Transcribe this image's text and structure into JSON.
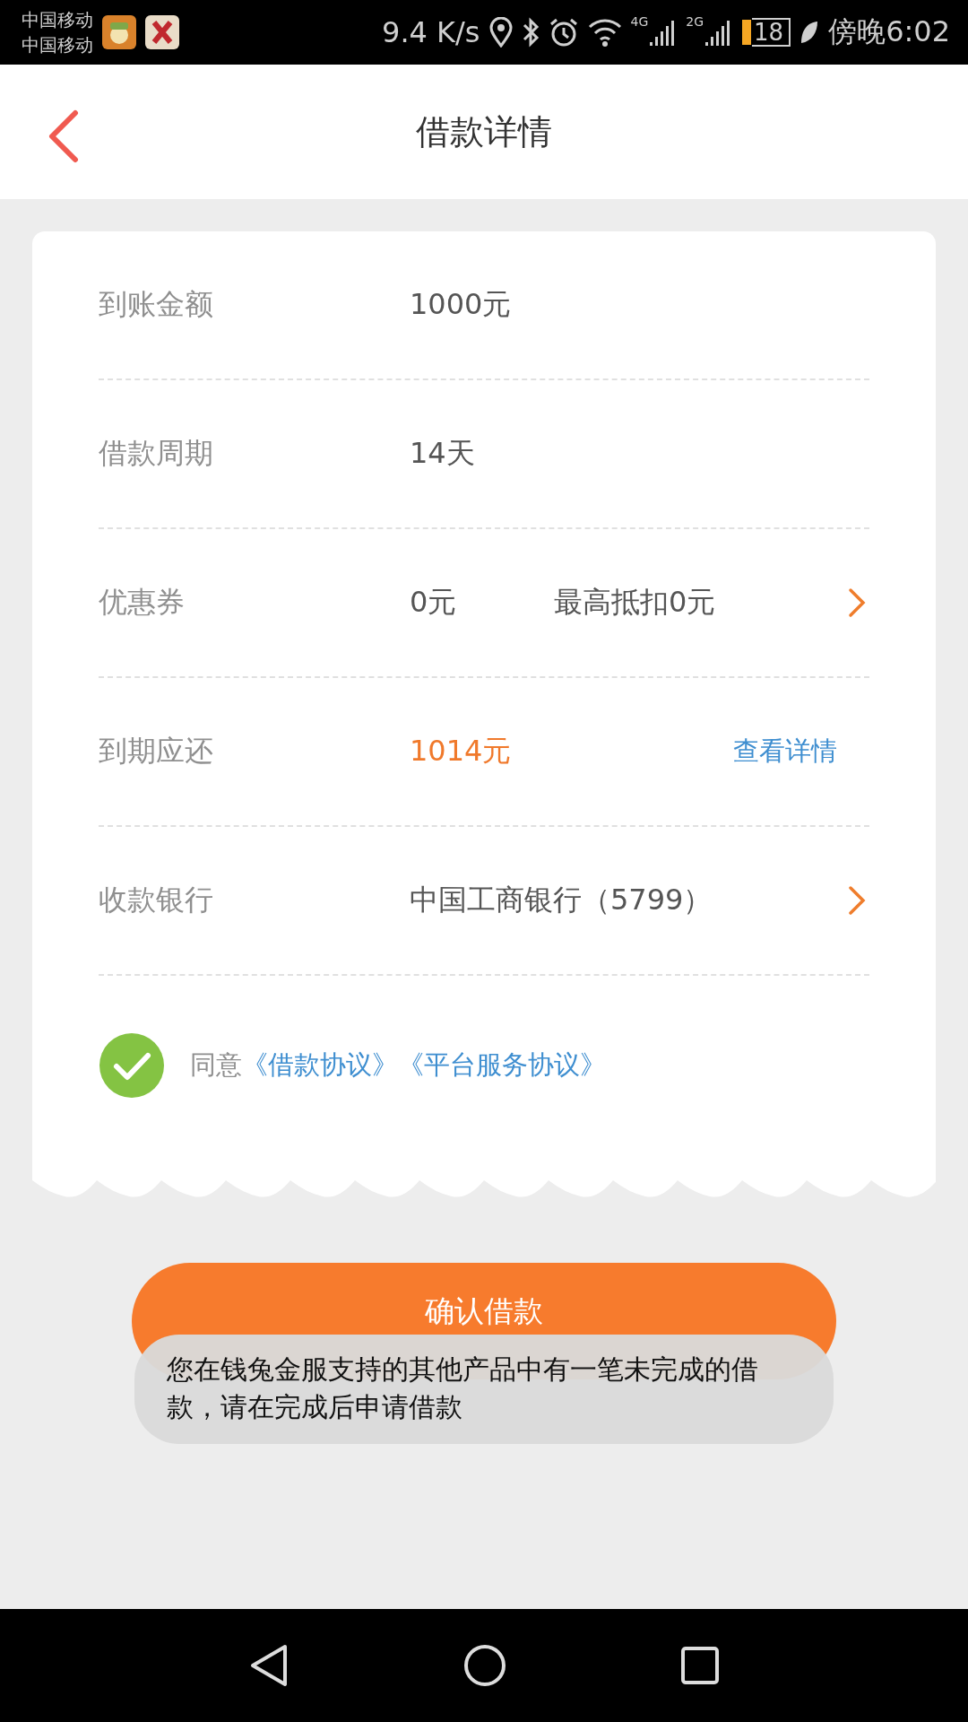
{
  "status_bar": {
    "carriers": [
      "中国移动",
      "中国移动"
    ],
    "speed": "9.4 K/s",
    "network_labels": [
      "4G",
      "2G"
    ],
    "battery": "18",
    "time": "傍晚6:02"
  },
  "header": {
    "title": "借款详情"
  },
  "rows": [
    {
      "label": "到账金额",
      "value": "1000元",
      "highlight": false,
      "chevron": false
    },
    {
      "label": "借款周期",
      "value": "14天",
      "highlight": false,
      "chevron": false
    },
    {
      "label": "优惠券",
      "value": "0元",
      "highlight": false,
      "extra": {
        "kind": "hint",
        "text": "最高抵扣0元"
      },
      "chevron": true
    },
    {
      "label": "到期应还",
      "value": "1014元",
      "highlight": true,
      "extra": {
        "kind": "link",
        "text": "查看详情"
      },
      "chevron": false
    },
    {
      "label": "收款银行",
      "value": "中国工商银行（5799）",
      "highlight": false,
      "chevron": true
    }
  ],
  "agreement": {
    "checked": true,
    "prefix": "同意",
    "links": [
      "《借款协议》",
      "《平台服务协议》"
    ]
  },
  "confirm_button": {
    "label": "确认借款"
  },
  "toast": {
    "text": "您在钱兔金服支持的其他产品中有一笔未完成的借款，请在完成后申请借款"
  }
}
